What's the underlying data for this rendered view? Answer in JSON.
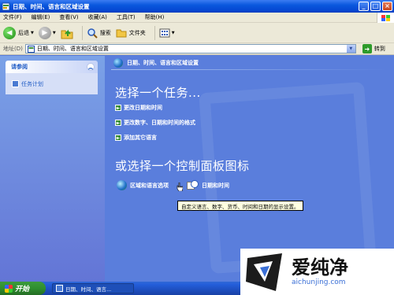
{
  "window": {
    "title": "日期、时间、语言和区域设置",
    "buttons": [
      "_",
      "□",
      "×"
    ]
  },
  "menu": [
    "文件(F)",
    "编辑(E)",
    "查看(V)",
    "收藏(A)",
    "工具(T)",
    "帮助(H)"
  ],
  "toolbar": {
    "back_label": "后退",
    "search_label": "搜索",
    "folders_label": "文件夹"
  },
  "address": {
    "label": "地址(D)",
    "value": "日期、时间、语言和区域设置",
    "go_label": "转到"
  },
  "sidebar": {
    "panel_title": "请参阅",
    "items": [
      {
        "label": "任务计划"
      }
    ]
  },
  "main": {
    "header": "日期、时间、语言和区域设置",
    "pick_task": "选择一个任务...",
    "tasks": [
      {
        "label": "更改日期和时间"
      },
      {
        "label": "更改数字、日期和时间的格式"
      },
      {
        "label": "添加其它语言"
      }
    ],
    "pick_icon": "或选择一个控制面板图标",
    "icons": [
      {
        "label": "区域和语言选项",
        "icon": "globe-icon"
      },
      {
        "label": "日期和时间",
        "icon": "clock-calendar-icon"
      }
    ],
    "tooltip": "自定义语言、数字、货币、时间和日期的显示设置。"
  },
  "taskbar": {
    "start_label": "开始",
    "window_label": "日期、时间、语言..."
  },
  "watermark": {
    "cn": "爱纯净",
    "url": "aichunjing.com"
  }
}
